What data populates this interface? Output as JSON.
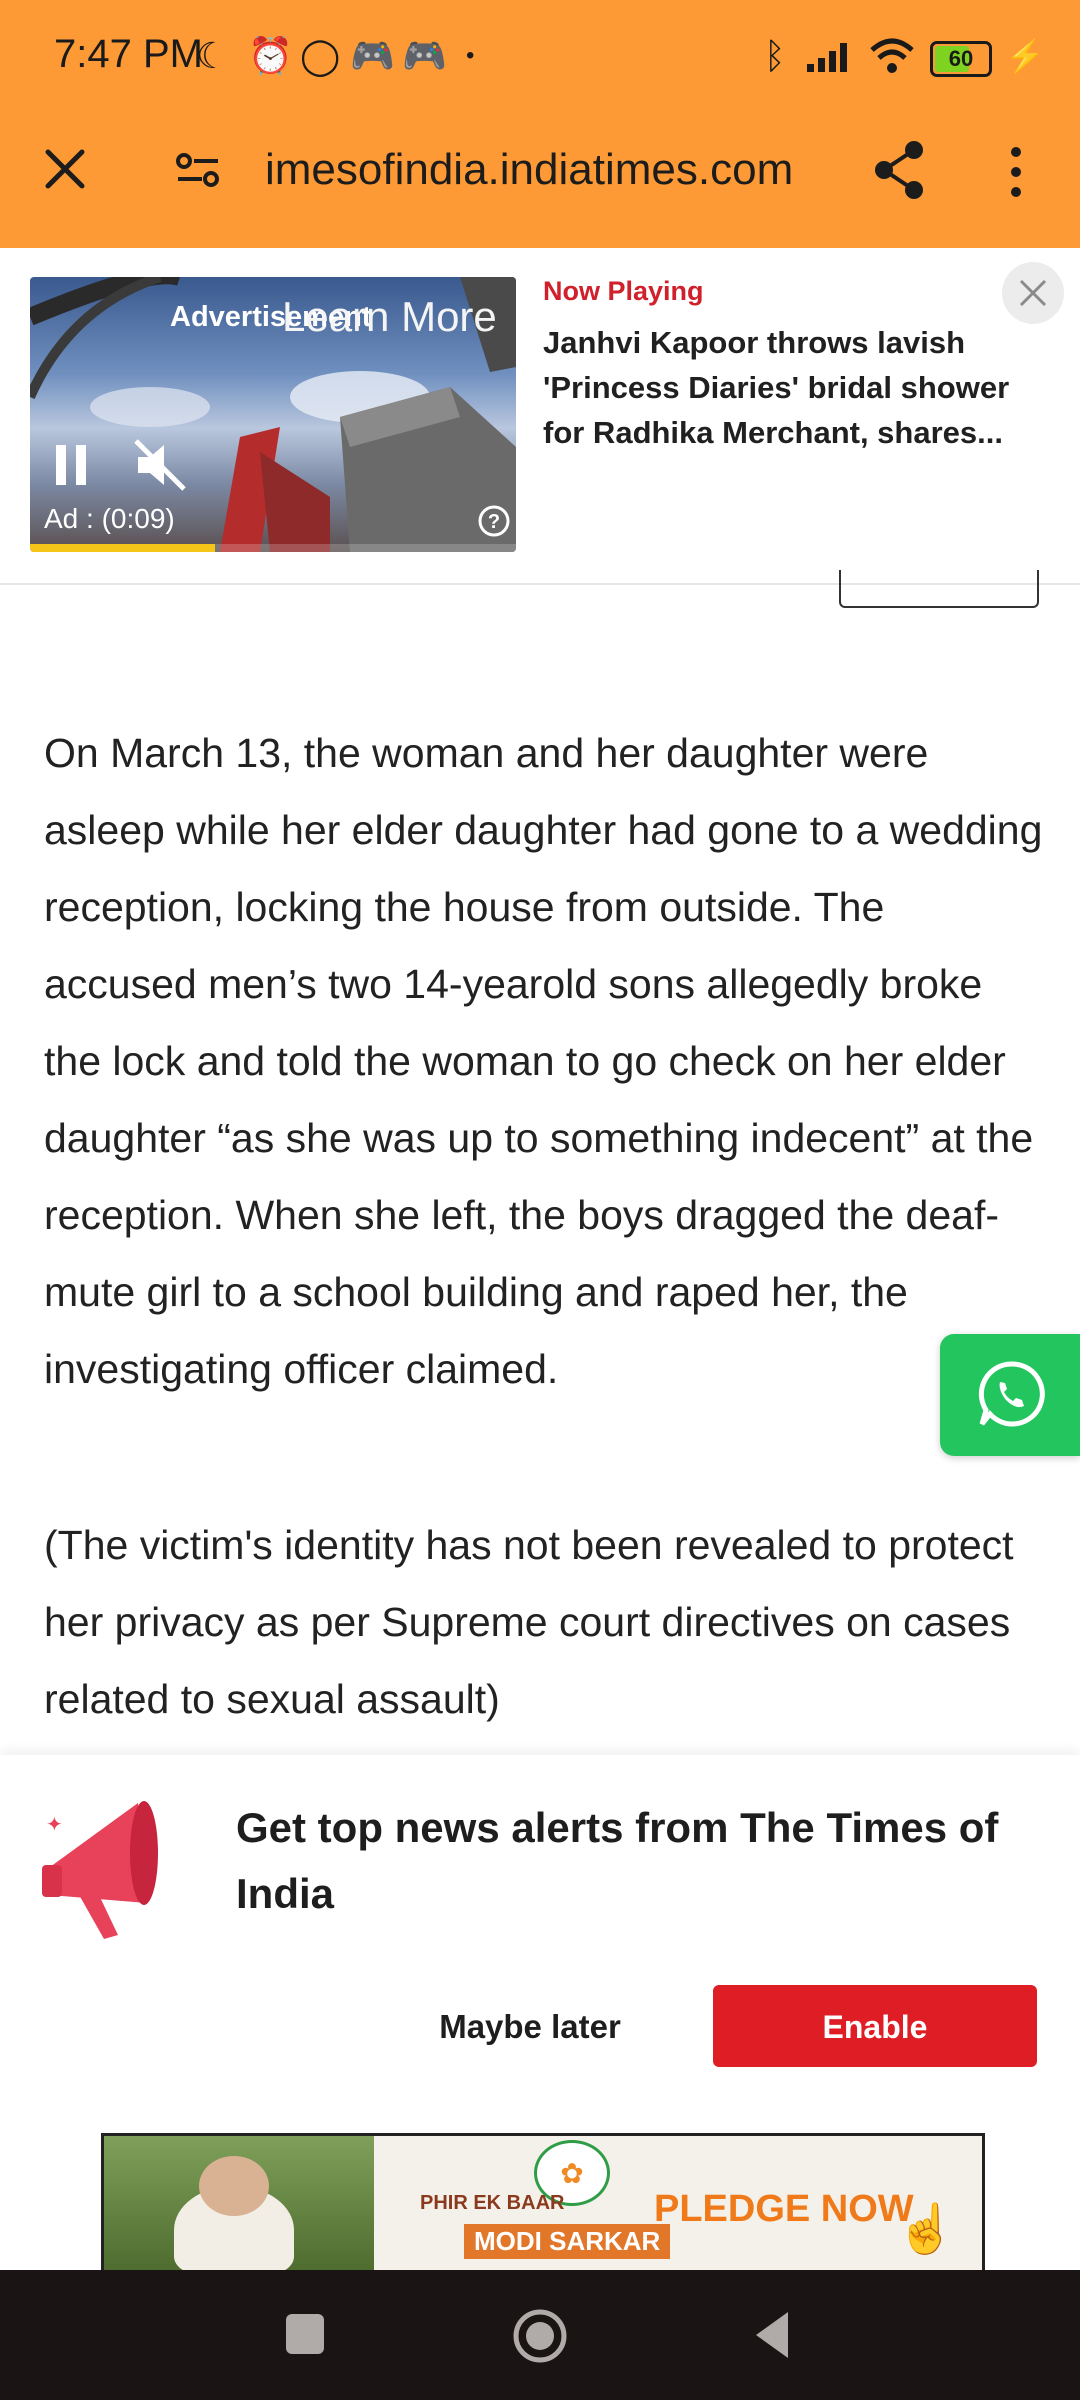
{
  "status_bar": {
    "time": "7:47 PM",
    "battery": "60"
  },
  "url_bar": {
    "url": "imesofindia.indiatimes.com"
  },
  "now_playing": {
    "ad_label": "Advertisement",
    "learn_more": "Learn More",
    "ad_timer": "Ad : (0:09)",
    "ad_progress": 0.38,
    "label": "Now Playing",
    "headline": "Janhvi Kapoor throws lavish 'Princess Diaries' bridal shower for Radhika Merchant, shares..."
  },
  "article": {
    "paragraph1": "On March 13, the woman and her daughter were asleep while her elder daughter had gone to a wedding reception, locking the house from outside. The accused men’s two 14-yearold sons allegedly broke the lock and told the woman to go check on her elder daughter “as she was up to something indecent” at the reception. When she left, the boys dragged the deaf-mute girl to a school building and raped her, the investigating officer claimed.",
    "paragraph2": "(The victim's identity has not been revealed to protect her privacy as per Supreme court directives on cases related to sexual assault)"
  },
  "notification_prompt": {
    "title": "Get top news alerts from The Times of India",
    "maybe_later": "Maybe later",
    "enable": "Enable"
  },
  "banner_ad": {
    "line1": "PHIR EK BAAR",
    "line2": "MODI SARKAR",
    "cta": "PLEDGE NOW"
  },
  "colors": {
    "browser_bar": "#fd9a35",
    "accent_red": "#df1d25",
    "whatsapp_green": "#22c55e"
  }
}
